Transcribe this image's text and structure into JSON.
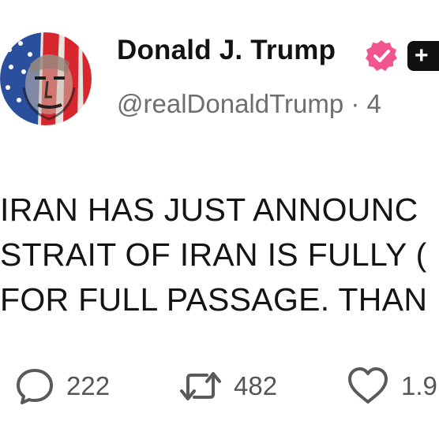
{
  "post": {
    "author": {
      "display_name": "Donald J. Trump",
      "handle_and_time": "@realDonaldTrump · 4",
      "verified_badge_color": "#f2548d",
      "avatar": "flag-portrait-avatar",
      "plus_badge_text": "+"
    },
    "body_lines": [
      "IRAN HAS JUST ANNOUNC",
      "STRAIT OF IRAN IS FULLY (",
      "FOR FULL PASSAGE. THAN"
    ],
    "actions": {
      "reply": {
        "icon": "reply-bubble-icon",
        "count": "222"
      },
      "repost": {
        "icon": "repost-arrows-icon",
        "count": "482"
      },
      "like": {
        "icon": "heart-icon",
        "count": "1.9"
      }
    }
  }
}
